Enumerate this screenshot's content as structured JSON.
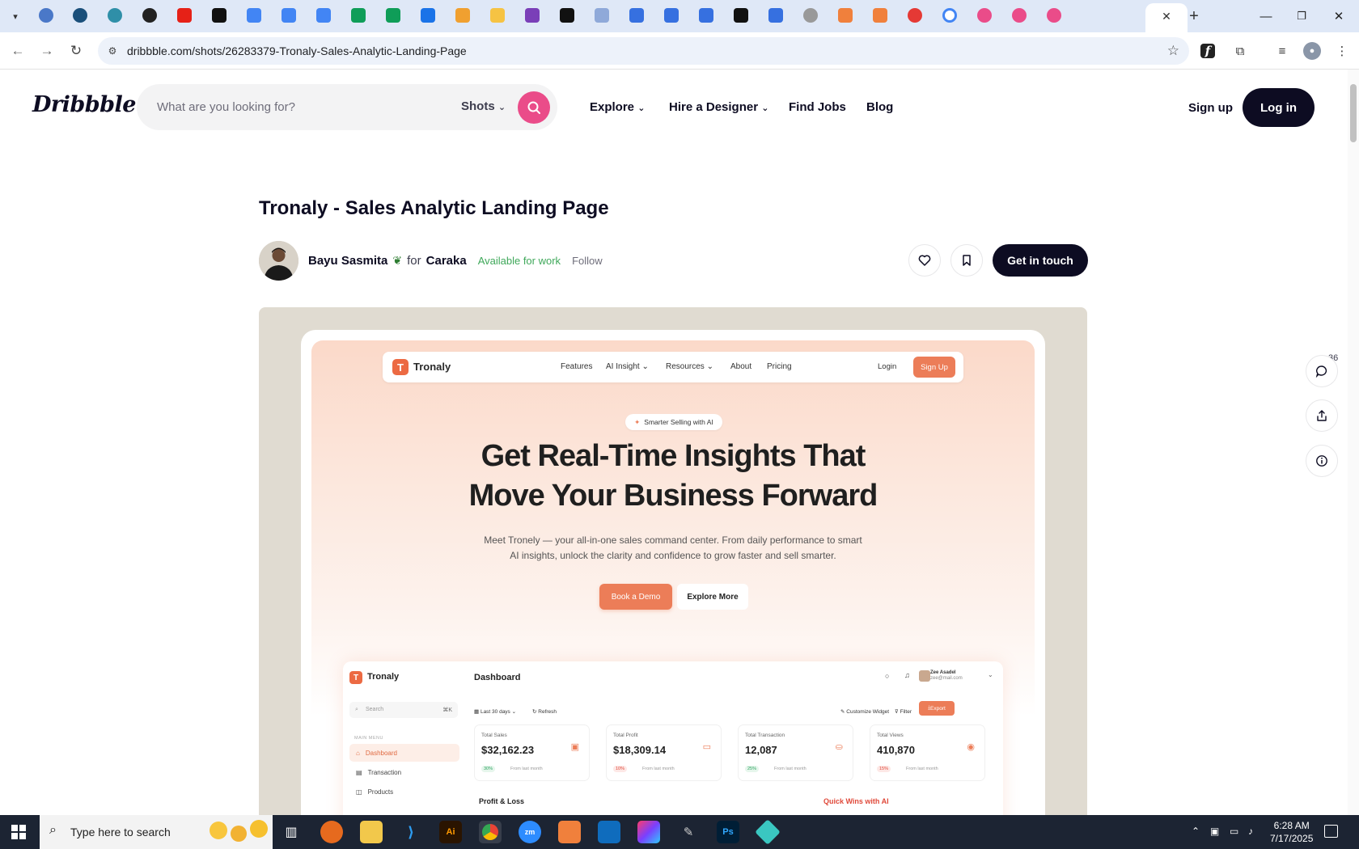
{
  "browser": {
    "url": "dribbble.com/shots/26283379-Tronaly-Sales-Analytic-Landing-Page",
    "tab_close": "✕",
    "new_tab": "+"
  },
  "header": {
    "logo": "Dribbble",
    "search_placeholder": "What are you looking for?",
    "search_type": "Shots",
    "nav": [
      "Explore",
      "Hire a Designer",
      "Find Jobs",
      "Blog"
    ],
    "signup": "Sign up",
    "login": "Log in"
  },
  "shot": {
    "title": "Tronaly - Sales Analytic Landing Page",
    "author": "Bayu Sasmita",
    "for_text": "for",
    "team": "Caraka",
    "availability": "Available for work",
    "follow": "Follow",
    "get_in_touch": "Get in touch",
    "comment_count": "36"
  },
  "mockup": {
    "brand": "Tronaly",
    "nav": [
      "Features",
      "AI Insight",
      "Resources",
      "About",
      "Pricing"
    ],
    "login": "Login",
    "signup": "Sign Up",
    "pill": "Smarter Selling with AI",
    "headline_1": "Get Real-Time Insights That",
    "headline_2": "Move Your Business Forward",
    "sub_1": "Meet Tronely — your all-in-one sales command center. From daily performance to smart",
    "sub_2": "AI insights, unlock the clarity and confidence to grow faster and sell smarter.",
    "cta_primary": "Book a Demo",
    "cta_secondary": "Explore More",
    "dashboard": {
      "brand": "Tronaly",
      "title": "Dashboard",
      "search": "Search",
      "search_shortcut": "⌘K",
      "section": "MAIN MENU",
      "menu": [
        "Dashboard",
        "Transaction",
        "Products"
      ],
      "user_name": "Zee Asadel",
      "user_email": "zee@mail.com",
      "range": "Last 30 days",
      "refresh": "Refresh",
      "customize": "Customize Widget",
      "filter": "Filter",
      "export": "Export",
      "cards": [
        {
          "label": "Total Sales",
          "value": "$32,162.23",
          "delta": "30%",
          "dir": "up",
          "from": "From last month"
        },
        {
          "label": "Total Profit",
          "value": "$18,309.14",
          "delta": "10%",
          "dir": "down",
          "from": "From last month"
        },
        {
          "label": "Total Transaction",
          "value": "12,087",
          "delta": "25%",
          "dir": "up",
          "from": "From last month"
        },
        {
          "label": "Total Views",
          "value": "410,870",
          "delta": "15%",
          "dir": "down",
          "from": "From last month"
        }
      ],
      "section_pl": "Profit & Loss",
      "section_qw": "Quick Wins with AI"
    }
  },
  "taskbar": {
    "search_placeholder": "Type here to search",
    "time": "6:28 AM",
    "date": "7/17/2025"
  },
  "colors": {
    "dribbble_pink": "#ea4c89",
    "dark": "#0d0c22",
    "tronaly_orange": "#ec7d58",
    "available_green": "#3fa85a"
  }
}
